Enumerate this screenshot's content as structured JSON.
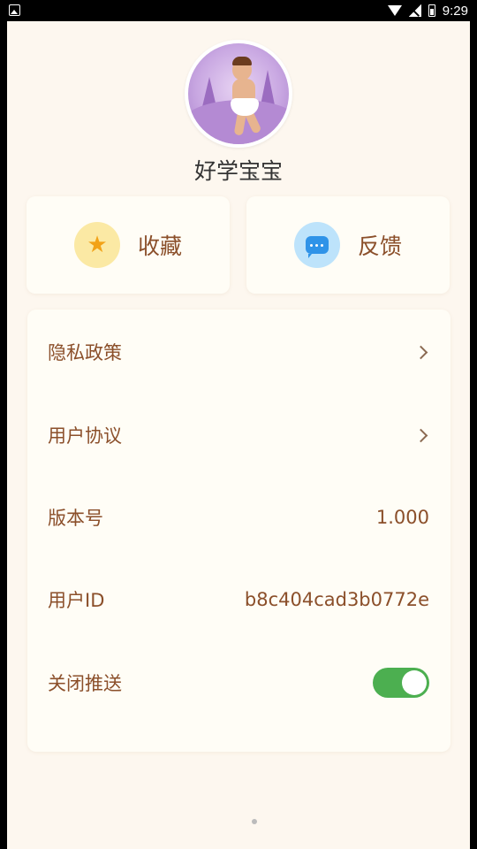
{
  "status_bar": {
    "time": "9:29",
    "icons": [
      "gallery-icon",
      "wifi-icon",
      "signal-off-icon",
      "battery-icon"
    ]
  },
  "profile": {
    "name": "好学宝宝"
  },
  "quick_actions": [
    {
      "label": "收藏",
      "icon": "star-icon",
      "icon_color": "#f2a217"
    },
    {
      "label": "反馈",
      "icon": "chat-bubble-icon",
      "icon_color": "#2f93e8"
    }
  ],
  "settings": {
    "privacy_policy": "隐私政策",
    "user_agreement": "用户协议",
    "version_label": "版本号",
    "version_value": "1.000",
    "user_id_label": "用户ID",
    "user_id_value": "b8c404cad3b0772e",
    "push_label": "关闭推送",
    "push_enabled": true
  },
  "colors": {
    "background": "#fdf7ef",
    "card": "#fffdf6",
    "text": "#8b4f2a",
    "toggle_on": "#4caf50"
  }
}
